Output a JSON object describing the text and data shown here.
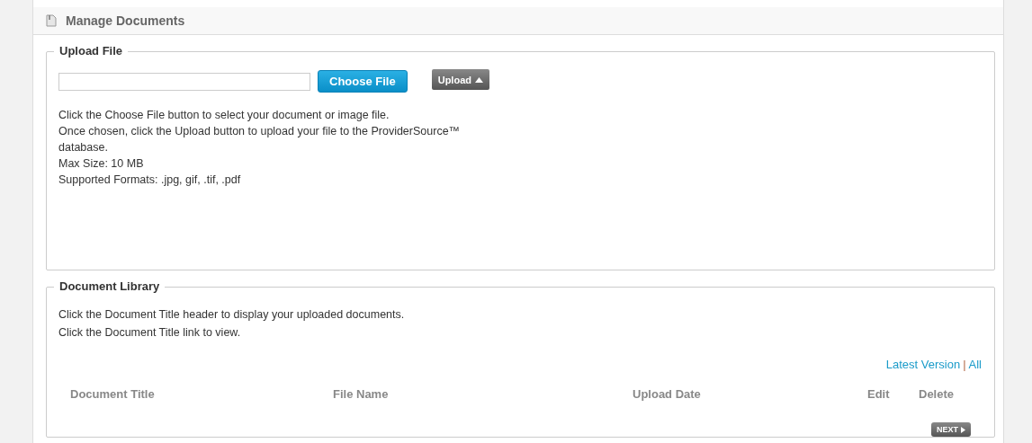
{
  "header": {
    "title": "Manage Documents"
  },
  "upload": {
    "legend": "Upload File",
    "choose_button": "Choose File",
    "upload_button": "Upload",
    "instructions": [
      "Click the Choose File button to select your document or image file.",
      "Once chosen, click the Upload button to upload your file to the ProviderSource™",
      "database.",
      "Max Size: 10 MB",
      "Supported Formats: .jpg, gif, .tif, .pdf"
    ]
  },
  "library": {
    "legend": "Document Library",
    "instructions": [
      "Click the Document Title header to display your uploaded documents.",
      "Click the Document Title link to view."
    ],
    "version_links": [
      {
        "label": "Latest Version"
      },
      {
        "label": "All"
      }
    ],
    "separator": "|",
    "columns": [
      "Document Title",
      "File Name",
      "Upload Date",
      "Edit",
      "Delete"
    ],
    "next_button": "NEXT"
  }
}
